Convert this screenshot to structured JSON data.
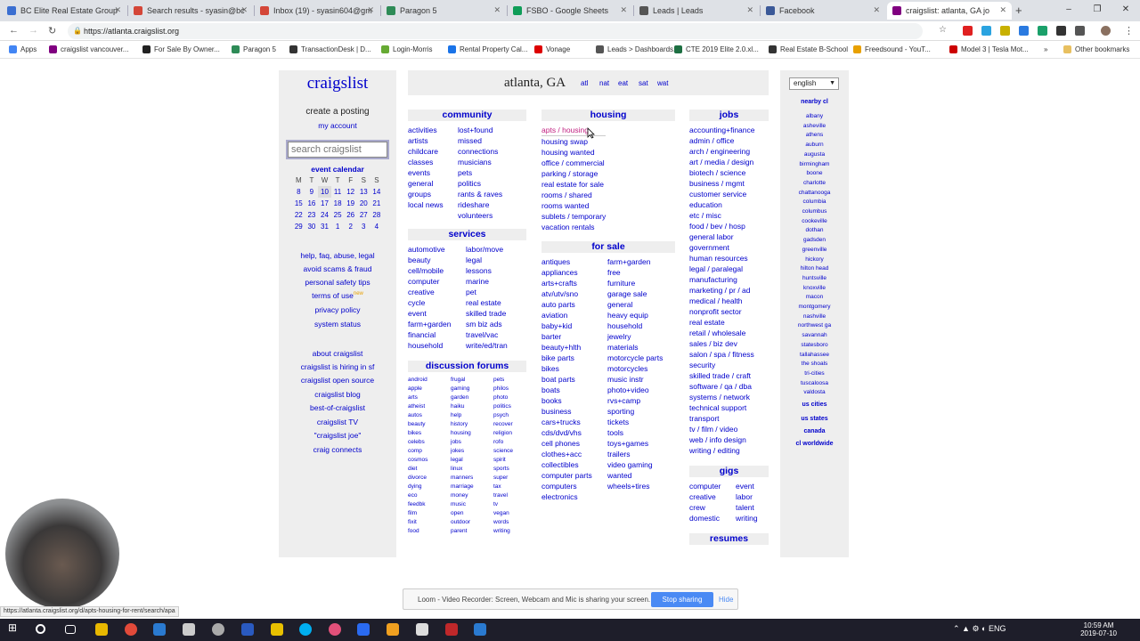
{
  "browser": {
    "tabs": [
      {
        "title": "BC Elite Real Estate Group",
        "icon": "bc-icon",
        "color": "#3b6fd1"
      },
      {
        "title": "Search results - syasin@bc",
        "icon": "gmail-icon",
        "color": "#d44638"
      },
      {
        "title": "Inbox (19) - syasin604@gm",
        "icon": "gmail-icon",
        "color": "#d44638"
      },
      {
        "title": "Paragon 5",
        "icon": "paragon-icon",
        "color": "#2e8b57"
      },
      {
        "title": "FSBO - Google Sheets",
        "icon": "sheets-icon",
        "color": "#0f9d58"
      },
      {
        "title": "Leads | Leads",
        "icon": "pin-icon",
        "color": "#555555"
      },
      {
        "title": "Facebook",
        "icon": "facebook-icon",
        "color": "#3b5998"
      },
      {
        "title": "craigslist: atlanta, GA jo",
        "icon": "craigslist-icon",
        "color": "#800080"
      }
    ],
    "url": "https://atlanta.craigslist.org",
    "bookmarks": [
      "Apps",
      "craigslist vancouver...",
      "For Sale By Owner...",
      "Paragon 5",
      "TransactionDesk | D...",
      "Login-Morris",
      "Rental Property Cal...",
      "Vonage",
      "Leads > Dashboards...",
      "CTE 2019 Elite 2.0.xl...",
      "Real Estate B-School",
      "Freedsound - YouT...",
      "Model 3 | Tesla Mot...",
      "»",
      "Other bookmarks"
    ]
  },
  "left": {
    "logo": "craigslist",
    "create_posting": "create a posting",
    "my_account": "my account",
    "search_placeholder": "search craigslist",
    "calendar_title": "event calendar",
    "calendar_days": [
      "M",
      "T",
      "W",
      "T",
      "F",
      "S",
      "S"
    ],
    "calendar_weeks": [
      [
        "8",
        "9",
        "10",
        "11",
        "12",
        "13",
        "14"
      ],
      [
        "15",
        "16",
        "17",
        "18",
        "19",
        "20",
        "21"
      ],
      [
        "22",
        "23",
        "24",
        "25",
        "26",
        "27",
        "28"
      ],
      [
        "29",
        "30",
        "31",
        "1",
        "2",
        "3",
        "4"
      ]
    ],
    "help_links": [
      "help, faq, abuse, legal",
      "avoid scams & fraud",
      "personal safety tips",
      "terms of use",
      "privacy policy",
      "system status"
    ],
    "new_badge": "new",
    "about_links": [
      "about craigslist",
      "craigslist is hiring in sf",
      "craigslist open source",
      "craigslist blog",
      "best-of-craigslist",
      "craigslist TV",
      "\"craigslist joe\"",
      "craig connects"
    ]
  },
  "center": {
    "city": "atlanta, GA",
    "city_shortcuts": [
      "atl",
      "nat",
      "eat",
      "sat",
      "wat"
    ],
    "community": {
      "title": "community",
      "col1": [
        "activities",
        "artists",
        "childcare",
        "classes",
        "events",
        "general",
        "groups",
        "local news"
      ],
      "col2": [
        "lost+found",
        "missed",
        "connections",
        "musicians",
        "pets",
        "politics",
        "rants & raves",
        "rideshare",
        "volunteers"
      ]
    },
    "services": {
      "title": "services",
      "col1": [
        "automotive",
        "beauty",
        "cell/mobile",
        "computer",
        "creative",
        "cycle",
        "event",
        "farm+garden",
        "financial",
        "household"
      ],
      "col2": [
        "labor/move",
        "legal",
        "lessons",
        "marine",
        "pet",
        "real estate",
        "skilled trade",
        "sm biz ads",
        "travel/vac",
        "write/ed/tran"
      ]
    },
    "discussion": {
      "title": "discussion forums",
      "col1": [
        "android",
        "apple",
        "arts",
        "atheist",
        "autos",
        "beauty",
        "bikes",
        "celebs",
        "comp",
        "cosmos",
        "diet",
        "divorce",
        "dying",
        "eco",
        "feedbk",
        "film",
        "fixit",
        "food"
      ],
      "col2": [
        "frugal",
        "gaming",
        "garden",
        "haiku",
        "help",
        "history",
        "housing",
        "jobs",
        "jokes",
        "legal",
        "linux",
        "manners",
        "marriage",
        "money",
        "music",
        "open",
        "outdoor",
        "parent"
      ],
      "col3": [
        "pets",
        "philos",
        "photo",
        "politics",
        "psych",
        "recover",
        "religion",
        "rofo",
        "science",
        "spirit",
        "sports",
        "super",
        "tax",
        "travel",
        "tv",
        "vegan",
        "words",
        "writing"
      ]
    },
    "housing": {
      "title": "housing",
      "items": [
        "apts / housing",
        "housing swap",
        "housing wanted",
        "office / commercial",
        "parking / storage",
        "real estate for sale",
        "rooms / shared",
        "rooms wanted",
        "sublets / temporary",
        "vacation rentals"
      ]
    },
    "forsale": {
      "title": "for sale",
      "col1": [
        "antiques",
        "appliances",
        "arts+crafts",
        "atv/utv/sno",
        "auto parts",
        "aviation",
        "baby+kid",
        "barter",
        "beauty+hlth",
        "bike parts",
        "bikes",
        "boat parts",
        "boats",
        "books",
        "business",
        "cars+trucks",
        "cds/dvd/vhs",
        "cell phones",
        "clothes+acc",
        "collectibles",
        "computer parts",
        "computers",
        "electronics"
      ],
      "col2": [
        "farm+garden",
        "free",
        "furniture",
        "garage sale",
        "general",
        "heavy equip",
        "household",
        "jewelry",
        "materials",
        "motorcycle parts",
        "motorcycles",
        "music instr",
        "photo+video",
        "rvs+camp",
        "sporting",
        "tickets",
        "tools",
        "toys+games",
        "trailers",
        "video gaming",
        "wanted",
        "wheels+tires"
      ]
    },
    "jobs": {
      "title": "jobs",
      "items": [
        "accounting+finance",
        "admin / office",
        "arch / engineering",
        "art / media / design",
        "biotech / science",
        "business / mgmt",
        "customer service",
        "education",
        "etc / misc",
        "food / bev / hosp",
        "general labor",
        "government",
        "human resources",
        "legal / paralegal",
        "manufacturing",
        "marketing / pr / ad",
        "medical / health",
        "nonprofit sector",
        "real estate",
        "retail / wholesale",
        "sales / biz dev",
        "salon / spa / fitness",
        "security",
        "skilled trade / craft",
        "software / qa / dba",
        "systems / network",
        "technical support",
        "transport",
        "tv / film / video",
        "web / info design",
        "writing / editing"
      ]
    },
    "gigs": {
      "title": "gigs",
      "col1": [
        "computer",
        "creative",
        "crew",
        "domestic"
      ],
      "col2": [
        "event",
        "labor",
        "talent",
        "writing"
      ]
    },
    "resumes": "resumes"
  },
  "right": {
    "language": "english",
    "nearby_title": "nearby cl",
    "nearby": [
      "albany",
      "asheville",
      "athens",
      "auburn",
      "augusta",
      "birmingham",
      "boone",
      "charlotte",
      "chattanooga",
      "columbia",
      "columbus",
      "cookeville",
      "dothan",
      "gadsden",
      "greenville",
      "hickory",
      "hilton head",
      "huntsville",
      "knoxville",
      "macon",
      "montgomery",
      "nashville",
      "northwest ga",
      "savannah",
      "statesboro",
      "tallahassee",
      "the shoals",
      "tri-cities",
      "tuscaloosa",
      "valdosta"
    ],
    "us_cities": "us cities",
    "us_states": "us states",
    "canada": "canada",
    "worldwide": "cl worldwide"
  },
  "overlay": {
    "loom_text": "Loom - Video Recorder: Screen, Webcam and Mic is sharing your screen.",
    "stop_sharing": "Stop sharing",
    "hide": "Hide",
    "status_url": "https://atlanta.craigslist.org/d/apts-housing-for-rent/search/apa"
  },
  "taskbar": {
    "lang": "ENG",
    "time": "10:59 AM",
    "date": "2019-07-10"
  }
}
